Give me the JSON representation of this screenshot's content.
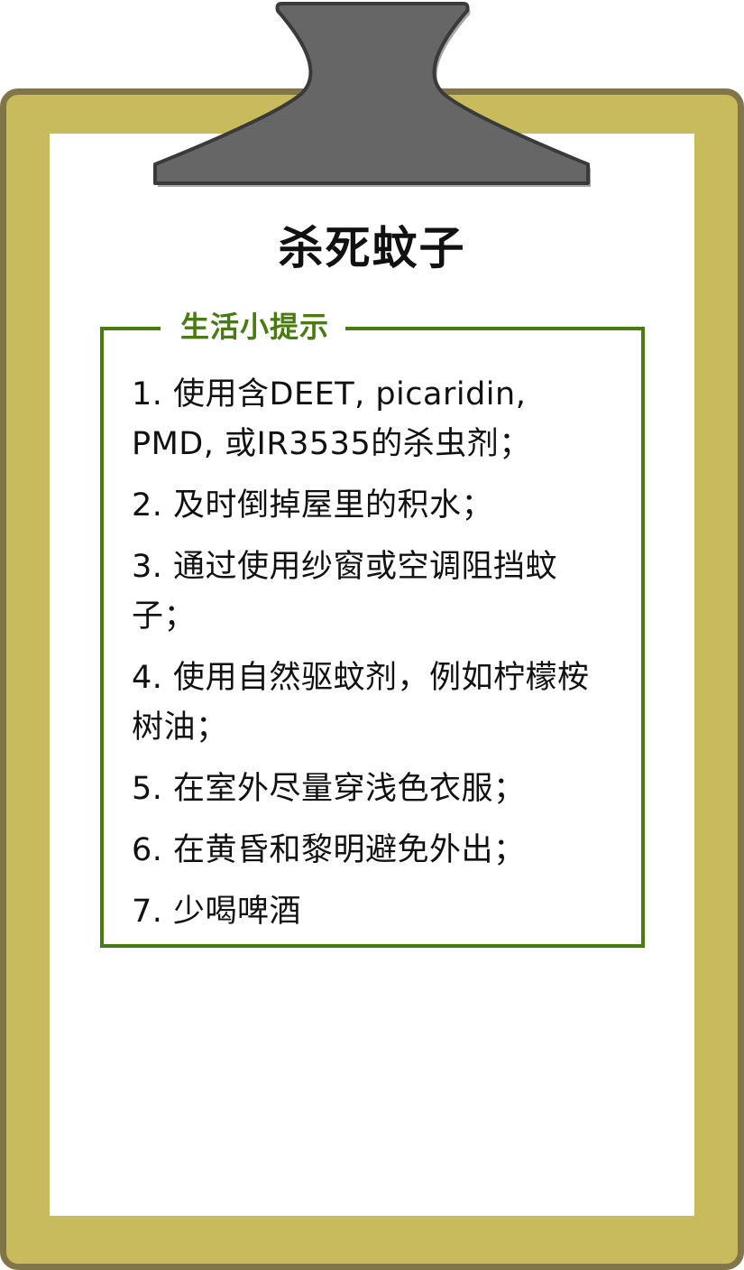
{
  "title": "杀死蚊子",
  "tips": {
    "legend": "生活小提示",
    "items": [
      "1. 使用含DEET, picaridin, PMD, 或IR3535的杀虫剂；",
      "2. 及时倒掉屋里的积水；",
      "3. 通过使用纱窗或空调阻挡蚊子；",
      "4. 使用自然驱蚊剂，例如柠檬桉树油；",
      "5. 在室外尽量穿浅色衣服；",
      "6. 在黄昏和黎明避免外出；",
      "7. 少喝啤酒"
    ]
  },
  "colors": {
    "board": "#c7bb5c",
    "board_border": "#807649",
    "clip": "#666666",
    "accent_green": "#4a7a12"
  }
}
